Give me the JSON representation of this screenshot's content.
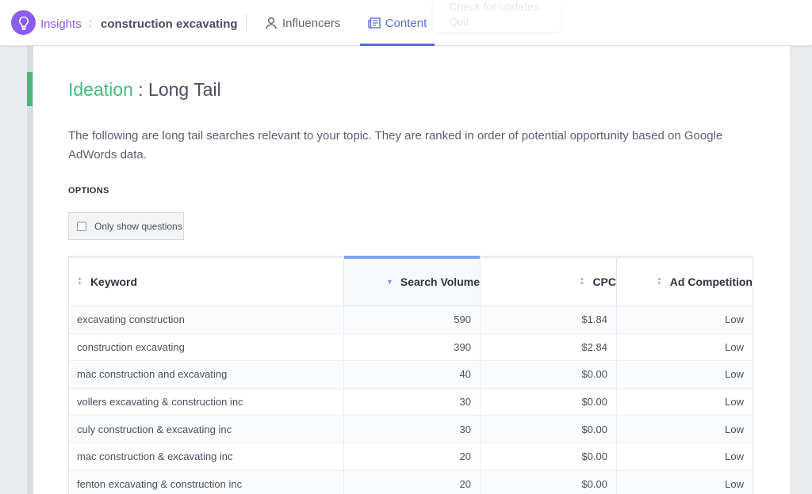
{
  "header": {
    "brand": "Insights",
    "separator": ":",
    "project": "construction excavating",
    "nav": [
      {
        "label": "Influencers",
        "icon": "person-icon"
      },
      {
        "label": "Content",
        "icon": "content-icon",
        "active": true
      }
    ]
  },
  "ghost_menu": {
    "items": [
      "Check for updates",
      "Quit"
    ]
  },
  "page": {
    "title_highlight": "Ideation",
    "title_rest": " : Long Tail",
    "description": "The following are long tail searches relevant to your topic. They are ranked in order of potential opportunity based on Google AdWords data.",
    "options_label": "OPTIONS",
    "questions_toggle": "Only show questions"
  },
  "table": {
    "columns": [
      {
        "label": "Keyword"
      },
      {
        "label": "Search Volume",
        "sorted": true
      },
      {
        "label": "CPC"
      },
      {
        "label": "Ad Competition"
      }
    ],
    "rows": [
      {
        "keyword": "excavating construction",
        "volume": "590",
        "cpc": "$1.84",
        "competition": "Low"
      },
      {
        "keyword": "construction excavating",
        "volume": "390",
        "cpc": "$2.84",
        "competition": "Low"
      },
      {
        "keyword": "mac construction and excavating",
        "volume": "40",
        "cpc": "$0.00",
        "competition": "Low"
      },
      {
        "keyword": "vollers excavating & construction inc",
        "volume": "30",
        "cpc": "$0.00",
        "competition": "Low"
      },
      {
        "keyword": "culy construction & excavating inc",
        "volume": "30",
        "cpc": "$0.00",
        "competition": "Low"
      },
      {
        "keyword": "mac construction & excavating inc",
        "volume": "20",
        "cpc": "$0.00",
        "competition": "Low"
      },
      {
        "keyword": "fenton excavating & construction inc",
        "volume": "20",
        "cpc": "$0.00",
        "competition": "Low"
      }
    ]
  },
  "colors": {
    "brand_purple": "#8c5cf0",
    "accent_green": "#3dbd7d",
    "nav_active_blue": "#5b6bd6",
    "sort_blue": "#7ea6ee"
  }
}
